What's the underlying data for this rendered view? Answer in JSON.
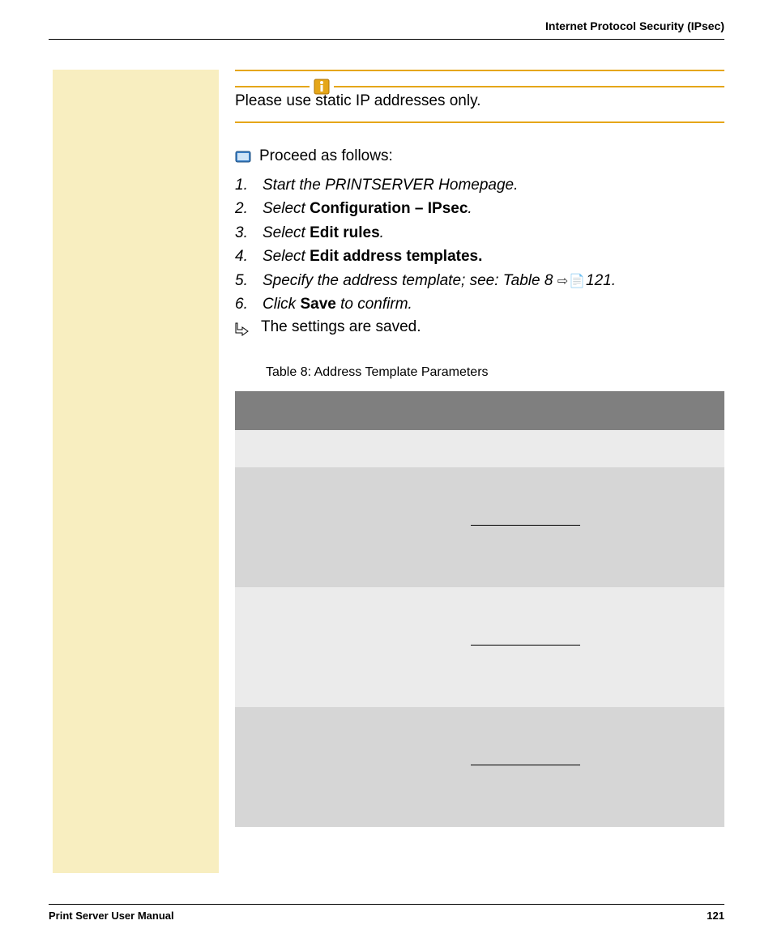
{
  "header_title": "Internet Protocol Security (IPsec)",
  "note_text": "Please use static IP addresses only.",
  "proceed_text": "Proceed as follows:",
  "steps": [
    {
      "num": "1.",
      "prefix": "Start the ",
      "bold": "",
      "rest": "PRINTSERVER Homepage.",
      "all_italic": true
    },
    {
      "num": "2.",
      "prefix": "Select ",
      "bold": "Configuration – IPsec",
      "rest": "."
    },
    {
      "num": "3.",
      "prefix": "Select ",
      "bold": "Edit rules",
      "rest": "."
    },
    {
      "num": "4.",
      "prefix": "Select ",
      "bold": "Edit address templates.",
      "rest": ""
    },
    {
      "num": "5.",
      "prefix": "Specify the address template; see: Table 8  ",
      "bold": "",
      "rest": "",
      "ref": "⇨📄",
      "ref_page": "121."
    },
    {
      "num": "6.",
      "prefix": "Click ",
      "bold": "Save",
      "rest": " to confirm."
    }
  ],
  "result_text": "The settings are saved.",
  "table_caption": "Table 8: Address Template Parameters",
  "footer_left": "Print Server User Manual",
  "footer_right": "121"
}
